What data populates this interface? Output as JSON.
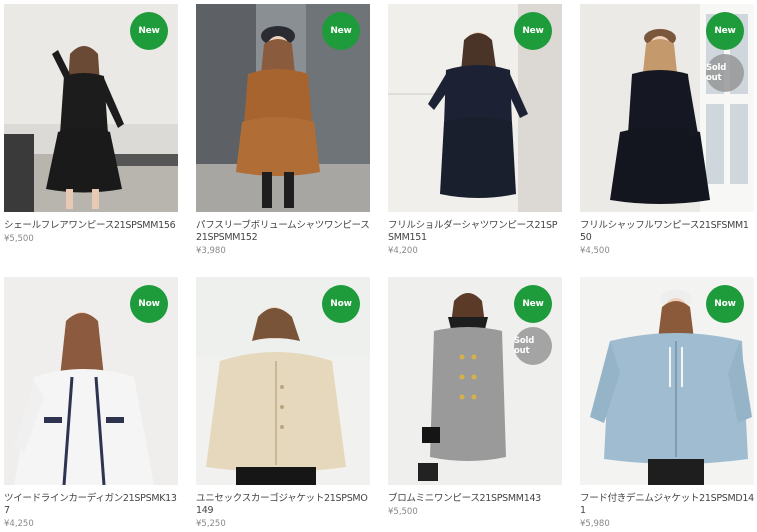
{
  "products": [
    {
      "name": "シェールフレアワンピース21SPSMM156",
      "price": "¥5,500",
      "badge_new": "New",
      "badge_sold": ""
    },
    {
      "name": "パフスリーブボリュームシャツワンピース21SPSMM152",
      "price": "¥3,980",
      "badge_new": "New",
      "badge_sold": ""
    },
    {
      "name": "フリルショルダーシャツワンピース21SPSMM151",
      "price": "¥4,200",
      "badge_new": "New",
      "badge_sold": ""
    },
    {
      "name": "フリルシャッフルワンピース21SFSMM150",
      "price": "¥4,500",
      "badge_new": "New",
      "badge_sold": "Sold out"
    },
    {
      "name": "ツイードラインカーディガン21SPSMK137",
      "price": "¥4,250",
      "badge_new": "Now",
      "badge_sold": ""
    },
    {
      "name": "ユニセックスカーゴジャケット21SPSMO149",
      "price": "¥5,250",
      "badge_new": "Now",
      "badge_sold": ""
    },
    {
      "name": "ブロムミニワンピース21SPSMM143",
      "price": "¥5,500",
      "badge_new": "New",
      "badge_sold": "Sold out"
    },
    {
      "name": "フード付きデニムジャケット21SPSMD141",
      "price": "¥5,980",
      "badge_new": "Now",
      "badge_sold": ""
    }
  ],
  "colors": {
    "badge_green": "#1e9b3a",
    "badge_gray": "#969696"
  }
}
